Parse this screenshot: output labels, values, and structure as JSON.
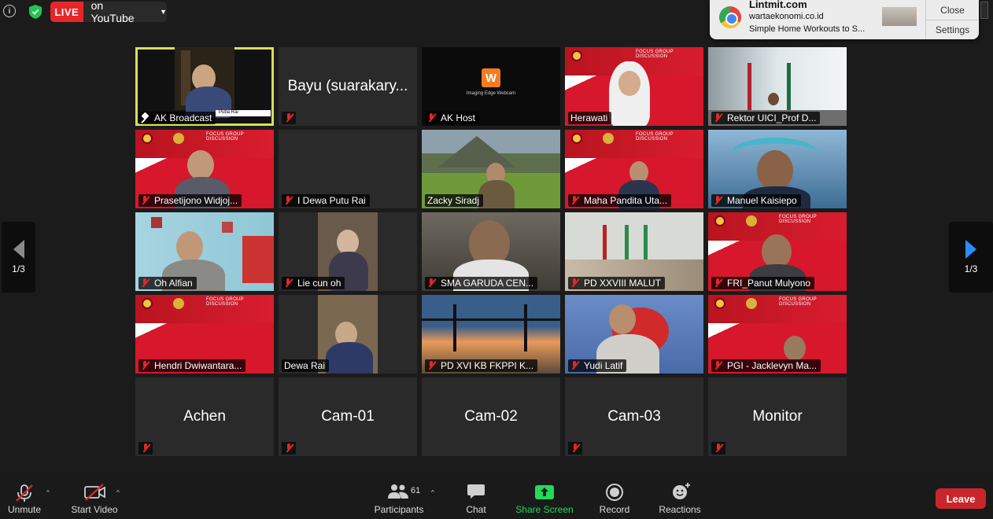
{
  "topbar": {
    "live_label": "LIVE",
    "live_destination": "on YouTube"
  },
  "notification": {
    "title": "Lintmit.com",
    "site": "wartaekonomi.co.id",
    "body": "Simple Home Workouts to S...",
    "close_label": "Close",
    "settings_label": "Settings"
  },
  "pager": {
    "left_label": "1/3",
    "right_label": "1/3"
  },
  "participants": [
    {
      "name": "AK Broadcast",
      "active": true
    },
    {
      "name": "Bayu (suarakary...",
      "video": false
    },
    {
      "name": "AK Host"
    },
    {
      "name": "Herawati"
    },
    {
      "name": "Rektor UICI_Prof D..."
    },
    {
      "name": "Prasetijono Widjoj..."
    },
    {
      "name": "I Dewa Putu Rai"
    },
    {
      "name": "Zacky Siradj"
    },
    {
      "name": "Maha Pandita Uta..."
    },
    {
      "name": "Manuel Kaisiepo"
    },
    {
      "name": "Oh Alfian"
    },
    {
      "name": "Lie cun oh"
    },
    {
      "name": "SMA GARUDA CEN..."
    },
    {
      "name": "PD XXVIII MALUT"
    },
    {
      "name": "FRI_Panut Mulyono"
    },
    {
      "name": "Hendri Dwiwantara..."
    },
    {
      "name": "Dewa Rai"
    },
    {
      "name": "PD XVI KB FKPPI K..."
    },
    {
      "name": "Yudi Latif"
    },
    {
      "name": "PGI - Jacklevyn Ma..."
    },
    {
      "name": "Achen",
      "video": false
    },
    {
      "name": "Cam-01",
      "video": false
    },
    {
      "name": "Cam-02",
      "video": false
    },
    {
      "name": "Cam-03",
      "video": false
    },
    {
      "name": "Monitor",
      "video": false
    }
  ],
  "overlay_texts": {
    "ak_broadcast_caption": "Puba Rai",
    "webcam_logo": "W",
    "webcam_text": "Imaging Edge Webcam",
    "fgd_title": "FOCUS GROUP DISCUSSION"
  },
  "toolbar": {
    "unmute_label": "Unmute",
    "start_video_label": "Start Video",
    "participants_label": "Participants",
    "participants_count": "61",
    "chat_label": "Chat",
    "share_screen_label": "Share Screen",
    "record_label": "Record",
    "reactions_label": "Reactions",
    "leave_label": "Leave"
  },
  "colors": {
    "live_red": "#e8262a",
    "active_speaker": "#d4e157",
    "share_green": "#23d959",
    "leave_red": "#c9262b",
    "pager_blue": "#2d8cff"
  }
}
